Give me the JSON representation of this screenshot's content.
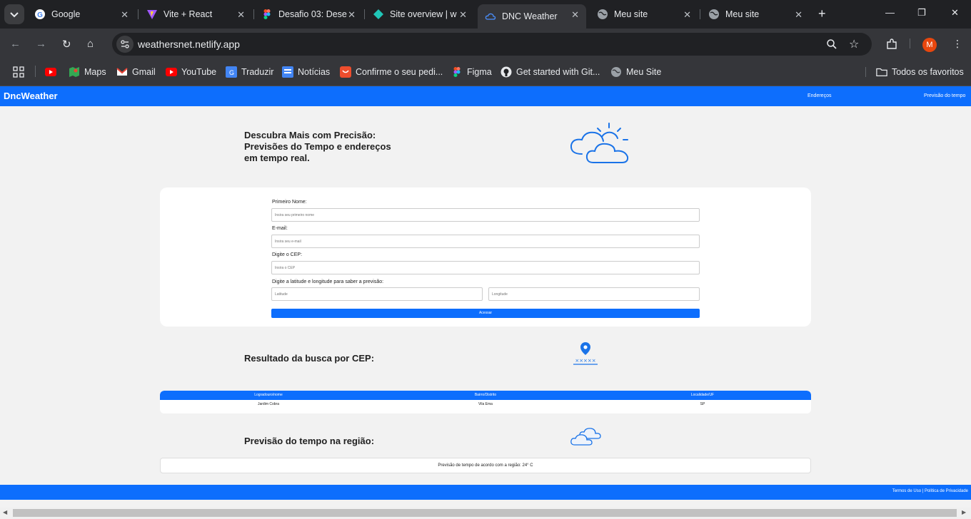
{
  "browser": {
    "tabs": [
      {
        "title": "Google",
        "icon": "google-icon"
      },
      {
        "title": "Vite + React",
        "icon": "vite-icon"
      },
      {
        "title": "Desafio 03: Dese",
        "icon": "figma-icon"
      },
      {
        "title": "Site overview | w",
        "icon": "netlify-icon"
      },
      {
        "title": "DNC Weather",
        "icon": "cloud-icon"
      },
      {
        "title": "Meu site",
        "icon": "globe-icon"
      },
      {
        "title": "Meu site",
        "icon": "globe-icon"
      }
    ],
    "url": "weathersnet.netlify.app",
    "profile_initial": "M",
    "bookmarks": [
      {
        "label": ""
      },
      {
        "label": "Maps"
      },
      {
        "label": "Gmail"
      },
      {
        "label": "YouTube"
      },
      {
        "label": "Traduzir"
      },
      {
        "label": "Notícias"
      },
      {
        "label": "Confirme o seu pedi..."
      },
      {
        "label": "Figma"
      },
      {
        "label": "Get started with Git..."
      },
      {
        "label": "Meu Site"
      }
    ],
    "all_bookmarks": "Todos os favoritos"
  },
  "header": {
    "brand": "DncWeather",
    "nav": [
      "Endereços",
      "Previsão do tempo"
    ]
  },
  "hero": {
    "title": "Descubra Mais com Precisão: Previsões do Tempo e endereços em tempo real."
  },
  "form": {
    "name_label": "Primeiro Nome:",
    "name_placeholder": "Insira seu primeiro nome",
    "email_label": "E-mail:",
    "email_placeholder": "Insira seu e-mail",
    "cep_label": "Digite o CEP:",
    "cep_placeholder": "Insira o CEP",
    "coords_label": "Digite a latitude e longitude para saber a previsão:",
    "lat_placeholder": "Latitude",
    "lng_placeholder": "Longitude",
    "submit_label": "Acessar"
  },
  "cep_result": {
    "title": "Resultado da busca por CEP:",
    "pin_text": "×××××",
    "columns": [
      "Logradouro/nome",
      "Bairro/Distrito",
      "Localidade/UF"
    ],
    "row": [
      "Jardim Cobra",
      "Vila Ema",
      "SP"
    ]
  },
  "forecast": {
    "title": "Previsão do tempo na região:",
    "text": "Previsão de tempo de acordo com a região: 24° C"
  },
  "footer": {
    "links": "Termos de Uso | Política de Privacidade"
  },
  "colors": {
    "primary": "#0d6efd",
    "background": "#f2f2f2"
  }
}
